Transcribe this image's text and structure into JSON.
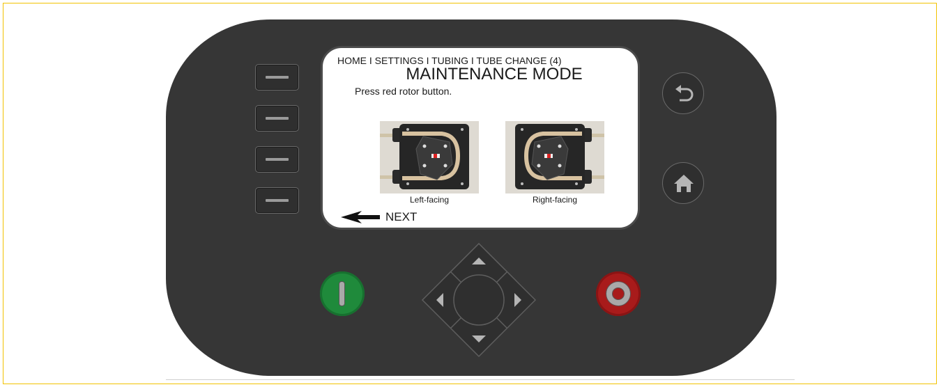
{
  "screen": {
    "breadcrumb": "HOME I SETTINGS I TUBING I TUBE CHANGE (4)",
    "title": "MAINTENANCE MODE",
    "instruction": "Press red rotor button.",
    "images": [
      {
        "caption": "Left-facing"
      },
      {
        "caption": "Right-facing"
      }
    ],
    "next_label": "NEXT"
  },
  "keypad": {
    "soft_keys": 4,
    "icons": {
      "back": "back-arrow-icon",
      "home": "home-icon",
      "run": "run-icon",
      "stop": "stop-icon",
      "up": "up-arrow-icon",
      "down": "down-arrow-icon",
      "left": "left-arrow-icon",
      "right": "right-arrow-icon"
    }
  },
  "colors": {
    "housing": "#363636",
    "run_green": "#1f8a3b",
    "stop_red": "#a81b1b",
    "tubing": "#d8c2a0"
  }
}
